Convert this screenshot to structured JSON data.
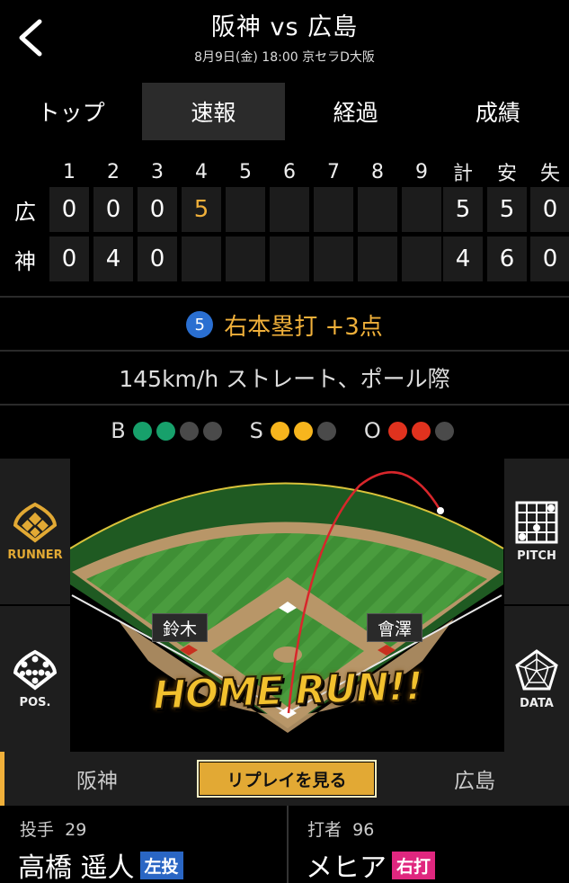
{
  "header": {
    "title": "阪神 vs 広島",
    "subtitle": "8月9日(金) 18:00 京セラD大阪"
  },
  "tabs": [
    "トップ",
    "速報",
    "経過",
    "成績"
  ],
  "active_tab": "速報",
  "scoreboard": {
    "headers": [
      "1",
      "2",
      "3",
      "4",
      "5",
      "6",
      "7",
      "8",
      "9",
      "計",
      "安",
      "失"
    ],
    "rows": [
      {
        "team": "広",
        "innings": [
          "0",
          "0",
          "0",
          "5",
          "",
          "",
          "",
          "",
          ""
        ],
        "totals": [
          "5",
          "5",
          "0"
        ]
      },
      {
        "team": "神",
        "innings": [
          "0",
          "4",
          "0",
          "",
          "",
          "",
          "",
          "",
          ""
        ],
        "totals": [
          "4",
          "6",
          "0"
        ]
      }
    ]
  },
  "play": {
    "inning": "5",
    "text": "右本塁打 +3点"
  },
  "pitch_info": "145km/h ストレート、ポール際",
  "count": {
    "b_label": "B",
    "s_label": "S",
    "o_label": "O",
    "balls": 2,
    "balls_max": 4,
    "strikes": 2,
    "strikes_max": 3,
    "outs": 2,
    "outs_max": 3,
    "colors": {
      "ball": "#17a06b",
      "strike": "#f7b51d",
      "out": "#e0321e",
      "empty": "#4a4a4a"
    }
  },
  "field": {
    "runners": [
      "鈴木",
      "會澤"
    ],
    "banner": "HOME RUN!!"
  },
  "side_buttons": {
    "runner": "RUNNER",
    "pos": "POS.",
    "pitch": "PITCH",
    "data": "DATA"
  },
  "team_bar": {
    "home": "阪神",
    "replay": "リプレイを見る",
    "away": "広島"
  },
  "pitcher": {
    "role": "投手",
    "number": "29",
    "name": "高橋 遥人",
    "badge": "左投"
  },
  "batter": {
    "role": "打者",
    "number": "96",
    "name": "メヒア",
    "badge": "右打"
  }
}
